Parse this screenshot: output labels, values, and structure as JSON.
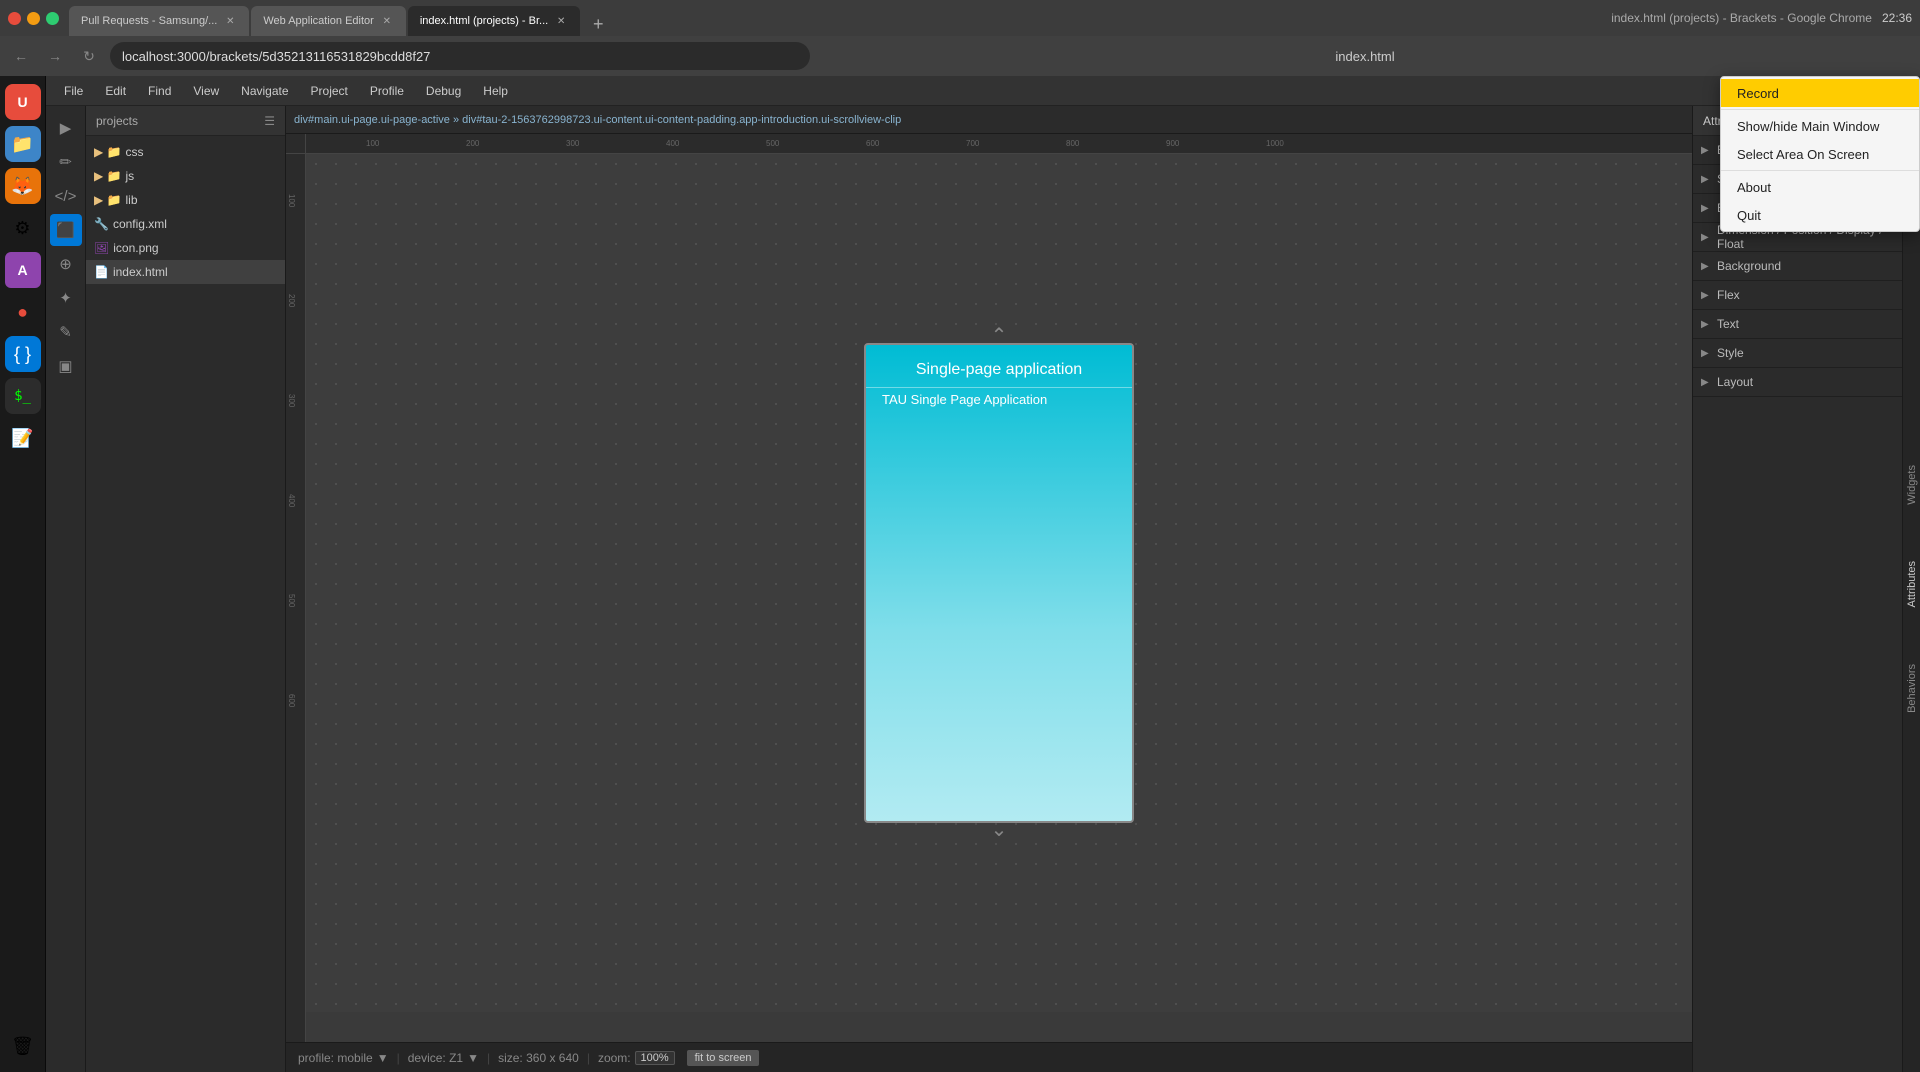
{
  "window": {
    "title": "index.html (projects) - Brackets - Google Chrome",
    "time": "22:36"
  },
  "tabs": [
    {
      "label": "Pull Requests - Samsung/...",
      "active": false,
      "closable": true
    },
    {
      "label": "Web Application Editor",
      "active": false,
      "closable": true
    },
    {
      "label": "index.html (projects) - Br...",
      "active": true,
      "closable": true
    }
  ],
  "address": "localhost:3000/brackets/5d35213116531829bcdd8f27",
  "menubar": {
    "items": [
      "File",
      "Edit",
      "Find",
      "View",
      "Navigate",
      "Project",
      "Profile",
      "Debug",
      "Help"
    ]
  },
  "editor_title": "index.html",
  "breadcrumb": "div#main.ui-page.ui-page-active » div#tau-2-1563762998723.ui-content.ui-content-padding.app-introduction.ui-scrollview-clip",
  "sidebar": {
    "project": "projects",
    "files": [
      {
        "name": "css",
        "type": "folder",
        "indent": 0
      },
      {
        "name": "js",
        "type": "folder",
        "indent": 0
      },
      {
        "name": "lib",
        "type": "folder",
        "indent": 0
      },
      {
        "name": "config.xml",
        "type": "xml",
        "indent": 0
      },
      {
        "name": "icon.png",
        "type": "png",
        "indent": 0
      },
      {
        "name": "index.html",
        "type": "html",
        "indent": 0,
        "selected": true
      }
    ]
  },
  "canvas": {
    "phone_title": "Single-page application",
    "phone_subtitle": "TAU Single Page Application"
  },
  "status_bar": {
    "profile": "profile: mobile",
    "device": "device: Z1",
    "size": "size: 360 x 640",
    "zoom_label": "zoom:",
    "zoom_value": "100%",
    "fit_btn": "fit to screen"
  },
  "attributes_panel": {
    "title": "Attributes",
    "sections": [
      {
        "label": "Element",
        "expanded": false
      },
      {
        "label": "Smart Things",
        "expanded": false
      },
      {
        "label": "Box Model",
        "expanded": false
      },
      {
        "label": "Dimension / Position / Display / Float",
        "expanded": false
      },
      {
        "label": "Background",
        "expanded": false
      },
      {
        "label": "Flex",
        "expanded": false
      },
      {
        "label": "Text",
        "expanded": false
      },
      {
        "label": "Style",
        "expanded": false
      },
      {
        "label": "Layout",
        "expanded": false
      }
    ]
  },
  "far_right": {
    "tabs": [
      "Widgets",
      "Attributes",
      "Behaviors"
    ]
  },
  "context_menu": {
    "items": [
      {
        "label": "Record",
        "highlighted": true
      },
      {
        "label": "Show/hide Main Window",
        "highlighted": false
      },
      {
        "label": "Select Area On Screen",
        "highlighted": false
      },
      {
        "label": "About",
        "highlighted": false
      },
      {
        "label": "Quit",
        "highlighted": false
      }
    ]
  },
  "toolbar": {
    "icons": [
      "▶",
      "✏",
      "&lt;/&gt;",
      "◆",
      "⊕",
      "↔",
      "✦",
      "▪"
    ]
  },
  "linux_taskbar": {
    "icons": [
      "🐧",
      "🦊",
      "⚙",
      "📁",
      "💻",
      "🖥",
      "📝",
      "📦",
      "🖼"
    ]
  }
}
